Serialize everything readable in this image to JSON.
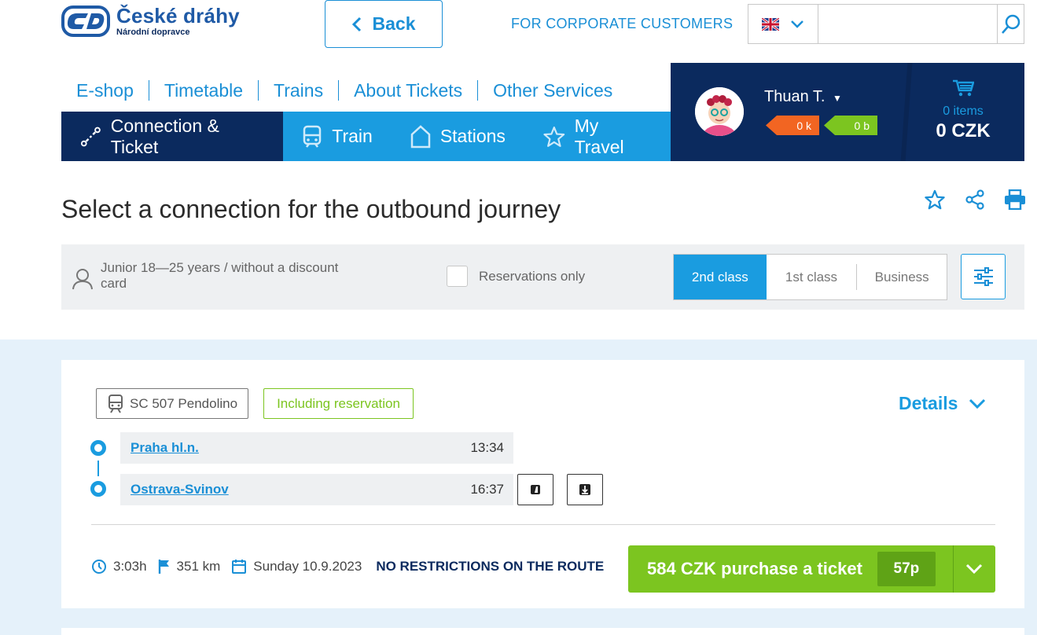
{
  "header": {
    "brand_name": "České dráhy",
    "brand_sub": "Národní dopravce",
    "back_label": "Back",
    "corporate_link": "FOR CORPORATE CUSTOMERS",
    "search_placeholder": ""
  },
  "top_nav": [
    "E-shop",
    "Timetable",
    "Trains",
    "About Tickets",
    "Other Services"
  ],
  "main_nav": {
    "connection": "Connection & Ticket",
    "train": "Train",
    "stations": "Stations",
    "my_travel": "My Travel"
  },
  "user": {
    "name": "Thuan T.",
    "kredit": "0 k",
    "bonus": "0 b",
    "cart_items": "0 items",
    "cart_total": "0 CZK"
  },
  "page": {
    "title": "Select a connection for the outbound journey"
  },
  "filters": {
    "passenger": "Junior 18—25 years / without a discount card",
    "reservations_only": "Reservations only",
    "class_2": "2nd class",
    "class_1": "1st class",
    "class_business": "Business"
  },
  "connection": {
    "train": "SC 507 Pendolino",
    "reservation_tag": "Including reservation",
    "details_label": "Details",
    "from_station": "Praha hl.n.",
    "from_time": "13:34",
    "to_station": "Ostrava-Svinov",
    "to_time": "16:37",
    "duration": "3:03h",
    "distance": "351 km",
    "date": "Sunday 10.9.2023",
    "restrictions": "NO RESTRICTIONS ON THE ROUTE",
    "buy_label": "584 CZK purchase a ticket",
    "points": "57p"
  },
  "colors": {
    "brand_blue": "#1a9ce0",
    "navy": "#0b2a5e",
    "green": "#7cc520",
    "orange": "#f26522"
  }
}
